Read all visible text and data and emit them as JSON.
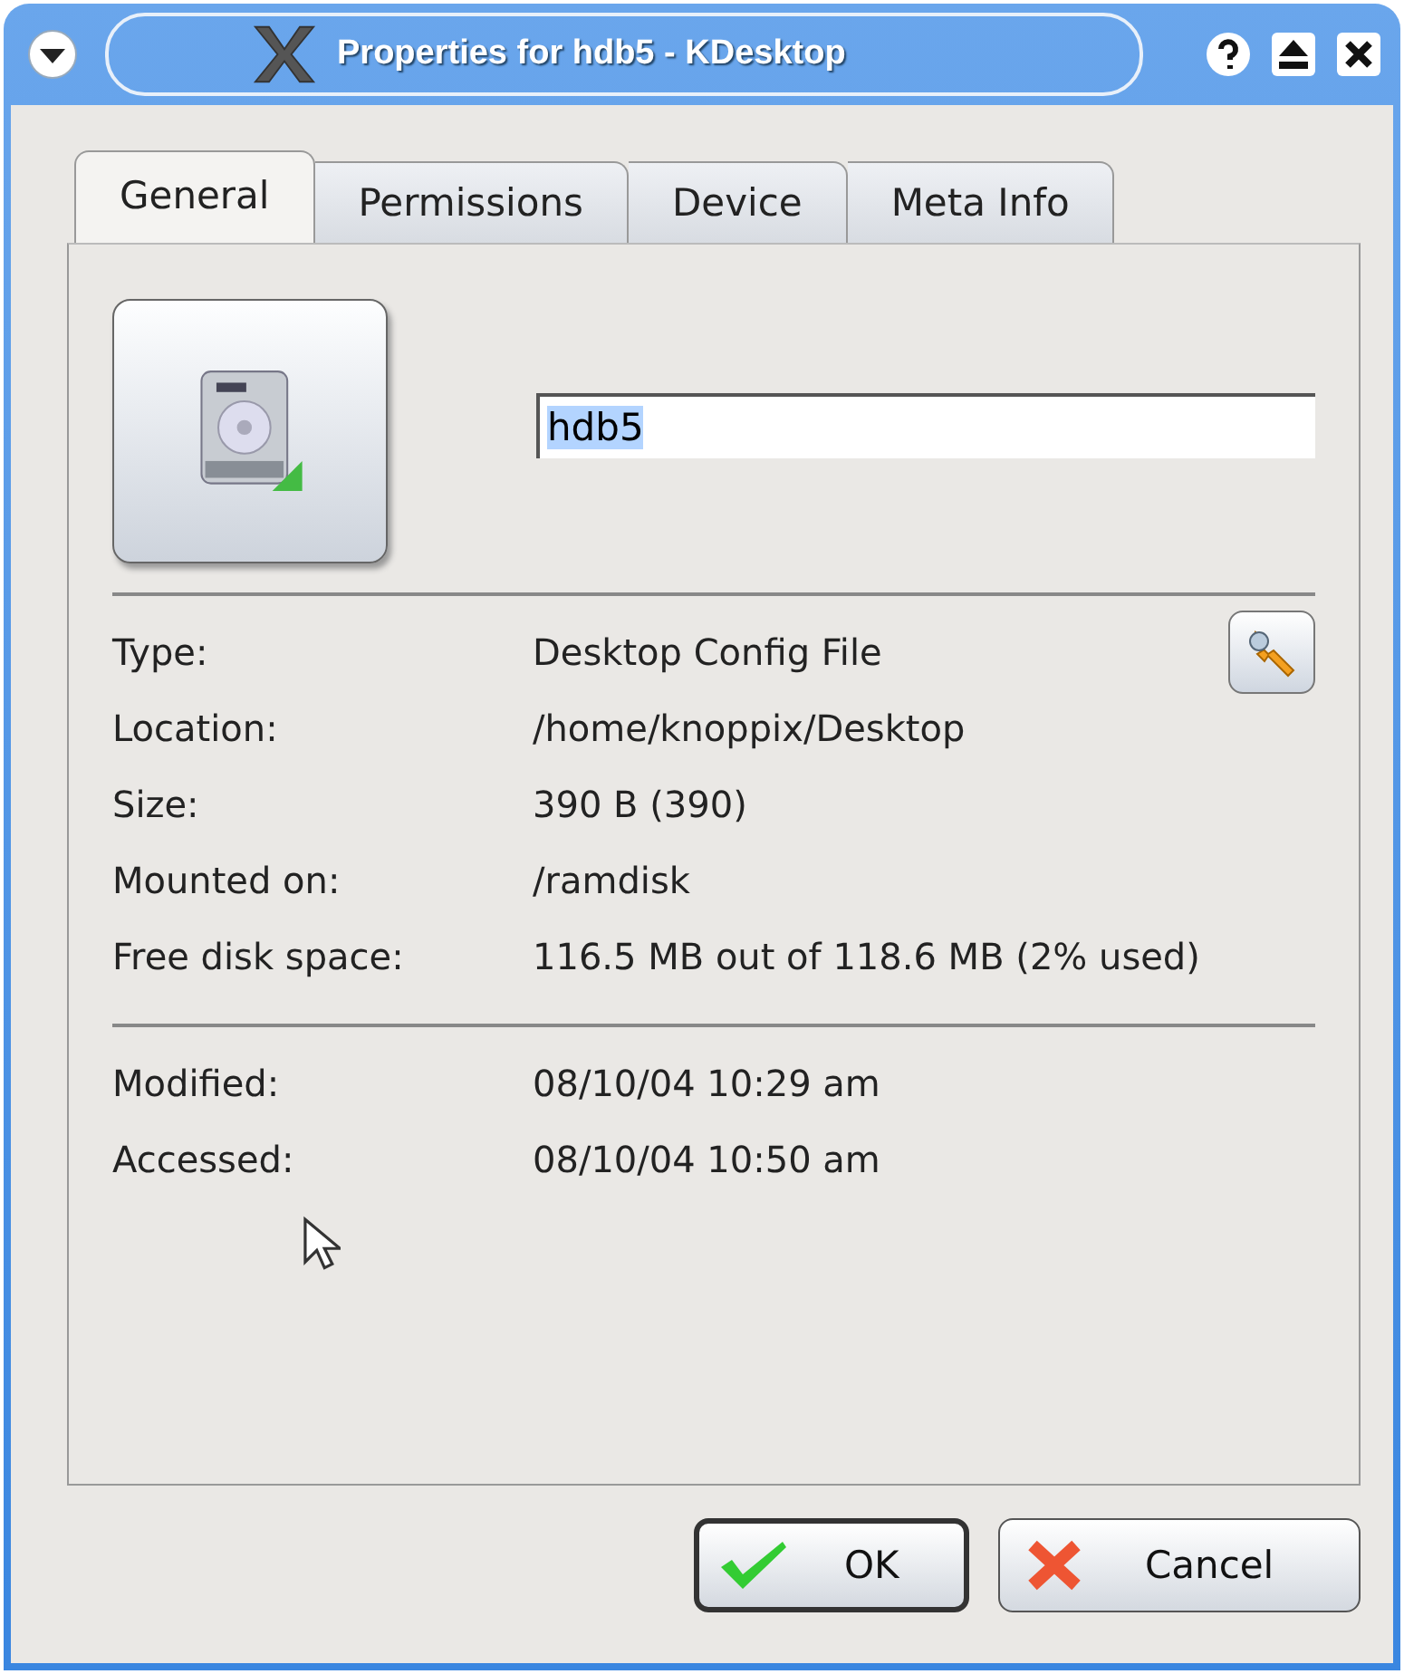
{
  "window": {
    "title": "Properties for hdb5 - KDesktop"
  },
  "tabs": [
    {
      "label": "General",
      "selected": true
    },
    {
      "label": "Permissions",
      "selected": false
    },
    {
      "label": "Device",
      "selected": false
    },
    {
      "label": "Meta Info",
      "selected": false
    }
  ],
  "name_field": {
    "value": "hdb5",
    "selected": true
  },
  "info": [
    {
      "label": "Type:",
      "value": "Desktop Config File",
      "kind": "edit"
    },
    {
      "label": "Location:",
      "value": "/home/knoppix/Desktop",
      "kind": "plain"
    },
    {
      "label": "Size:",
      "value": "390 B (390)",
      "kind": "plain"
    },
    {
      "label": "Mounted on:",
      "value": "/ramdisk",
      "kind": "plain"
    },
    {
      "label": "Free disk space:",
      "value": "116.5 MB out of 118.6 MB (2% used)",
      "kind": "plain"
    }
  ],
  "times": [
    {
      "label": "Modified:",
      "value": "08/10/04 10:29 am"
    },
    {
      "label": "Accessed:",
      "value": "08/10/04 10:50 am"
    }
  ],
  "buttons": [
    {
      "label": "OK",
      "kind": "ok",
      "default": true
    },
    {
      "label": "Cancel",
      "kind": "cancel",
      "default": false
    }
  ]
}
